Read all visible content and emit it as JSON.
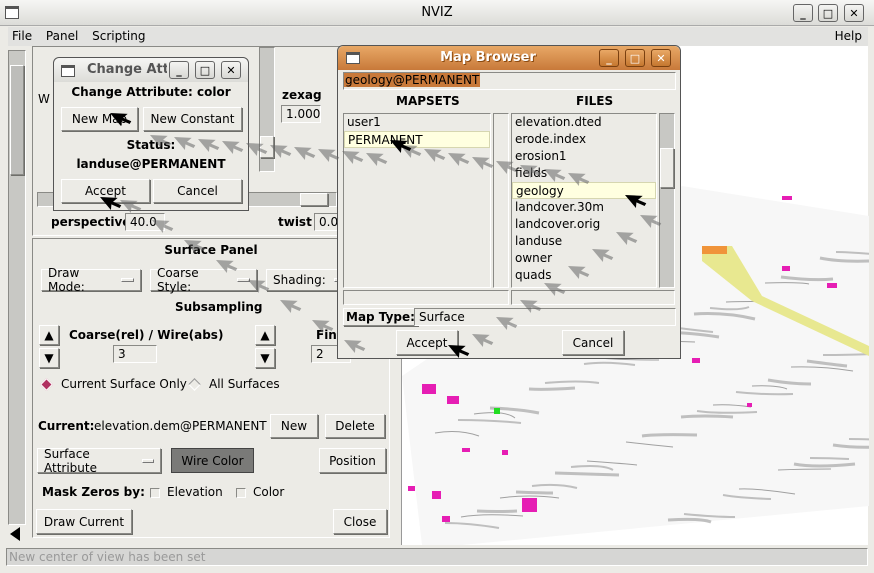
{
  "window": {
    "title": "NVIZ"
  },
  "menu": {
    "items": [
      "File",
      "Panel",
      "Scripting"
    ],
    "help": "Help"
  },
  "view_panel": {
    "w_label": "W",
    "zexag_label": "zexag",
    "zexag_value": "1.000",
    "perspective_label": "perspective",
    "perspective_value": "40.0",
    "twist_label": "twist",
    "twist_value": "0.0"
  },
  "surface_panel": {
    "title": "Surface Panel",
    "draw_mode": "Draw Mode:",
    "coarse_style": "Coarse Style:",
    "shading": "Shading:",
    "subsampling": "Subsampling",
    "coarse_label": "Coarse(rel) / Wire(abs)",
    "coarse_value": "3",
    "fine_label": "Fine",
    "fine_value": "2",
    "radio_current": "Current Surface Only",
    "radio_all": "All Surfaces",
    "radio_selected": "Current Surface Only",
    "current_label": "Current:",
    "current_value": "elevation.dem@PERMANENT",
    "new": "New",
    "delete": "Delete",
    "surface_attribute": "Surface Attribute",
    "wire_color": "Wire Color",
    "position": "Position",
    "mask_label": "Mask Zeros by:",
    "mask_elevation": "Elevation",
    "mask_color": "Color",
    "mask_elevation_checked": false,
    "mask_color_checked": false,
    "draw_current": "Draw Current",
    "close": "Close"
  },
  "change_attr": {
    "title": "Change Attı",
    "heading": "Change Attribute: color",
    "new_map": "New Map",
    "new_constant": "New Constant",
    "status_label": "Status:",
    "status_value": "landuse@PERMANENT",
    "accept": "Accept",
    "cancel": "Cancel"
  },
  "map_browser": {
    "title": "Map Browser",
    "selection": "geology@PERMANENT",
    "mapsets_header": "MAPSETS",
    "files_header": "FILES",
    "mapsets": [
      "user1",
      "PERMANENT"
    ],
    "selected_mapset": "PERMANENT",
    "files": [
      "elevation.dted",
      "erode.index",
      "erosion1",
      "fields",
      "geology",
      "landcover.30m",
      "landcover.orig",
      "landuse",
      "owner",
      "quads"
    ],
    "selected_file": "geology",
    "map_type_label": "Map Type:",
    "map_type_value": "Surface",
    "accept": "Accept",
    "cancel": "Cancel"
  },
  "status_bar": {
    "message": "New center of view has been set"
  },
  "colors": {
    "mapbrowser_titlebar": "#d4873f",
    "selection_highlight": "#ffffe0",
    "radio_selected": "#b03060",
    "canvas": "#ffffff",
    "landuse_magenta": "#e61eb4"
  }
}
